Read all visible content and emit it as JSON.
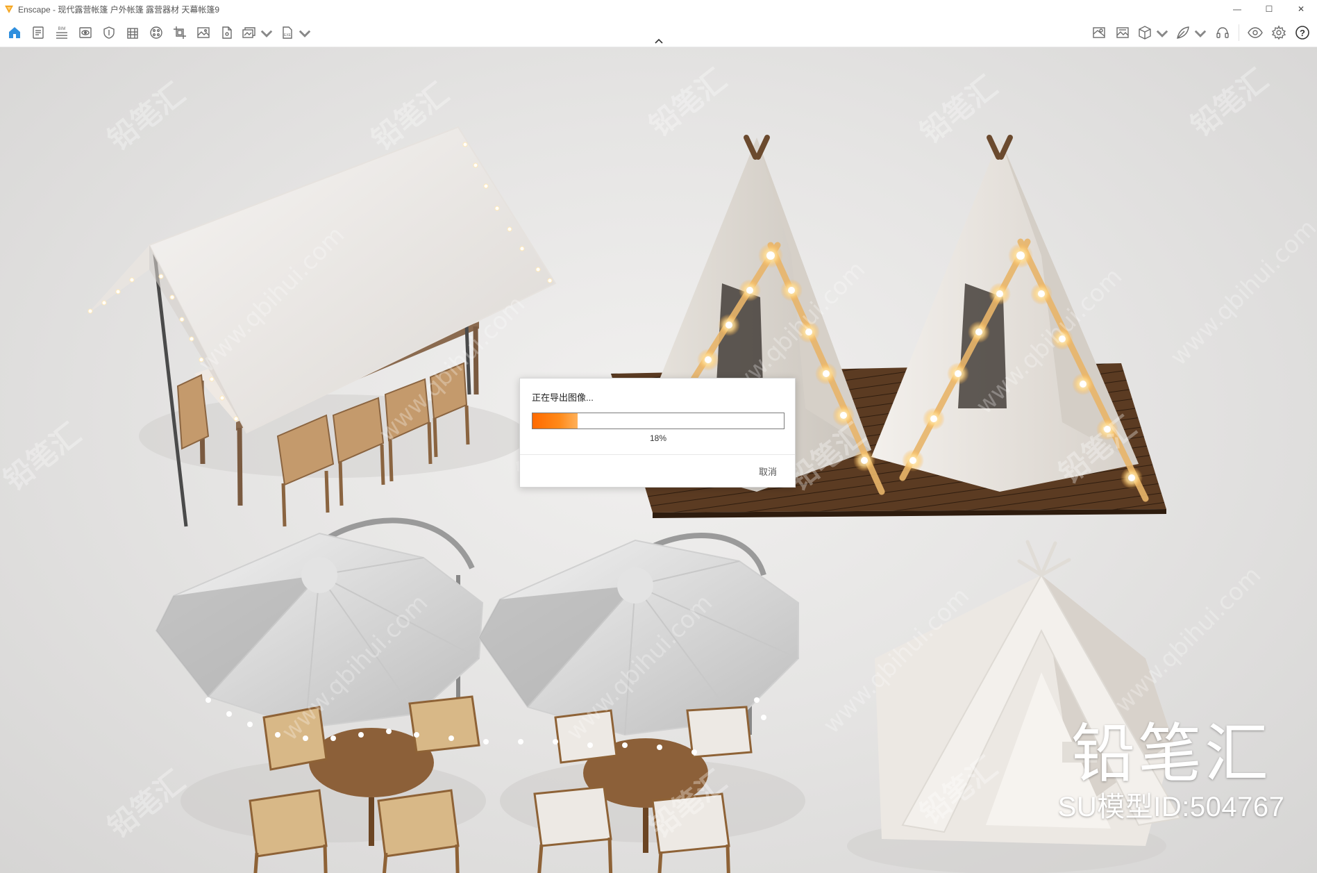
{
  "window": {
    "title": "Enscape - 现代露营帐篷 户外帐篷 露营器材 天幕帐篷9",
    "minimize": "—",
    "maximize": "☐",
    "close": "✕"
  },
  "toolbar": {
    "left": [
      {
        "id": "home-icon",
        "label": "home"
      },
      {
        "id": "doc-icon",
        "label": "document"
      },
      {
        "id": "bim-icon",
        "label": "BIM"
      },
      {
        "id": "view-icon",
        "label": "view"
      },
      {
        "id": "shield-icon",
        "label": "shield"
      },
      {
        "id": "building-icon",
        "label": "building"
      },
      {
        "id": "palette-icon",
        "label": "palette"
      },
      {
        "id": "crop-icon",
        "label": "crop"
      },
      {
        "id": "image-icon",
        "label": "image"
      },
      {
        "id": "file-icon",
        "label": "file"
      },
      {
        "id": "batch-icon",
        "label": "batch"
      },
      {
        "id": "exe-icon",
        "label": "EXE"
      }
    ],
    "bim_label": "BIM",
    "exe_label": "EXE",
    "right": [
      {
        "id": "map-icon"
      },
      {
        "id": "gallery-icon"
      },
      {
        "id": "cube-icon"
      },
      {
        "id": "leaf-icon"
      },
      {
        "id": "headset-icon"
      },
      {
        "id": "eye-icon"
      },
      {
        "id": "gear-icon"
      },
      {
        "id": "help-icon"
      }
    ],
    "help_label": "?"
  },
  "accent_color": "#2f8fde",
  "progress_color": "#ff7a10",
  "scene": {
    "brand_text": "铅笔汇",
    "model_id": "SU模型ID:504767",
    "watermark_text": "www.qbihui.com",
    "watermark_brand": "铅笔汇"
  },
  "dialog": {
    "title": "正在导出图像...",
    "progress": 0.18,
    "progress_label": "18%",
    "cancel_label": "取消"
  }
}
